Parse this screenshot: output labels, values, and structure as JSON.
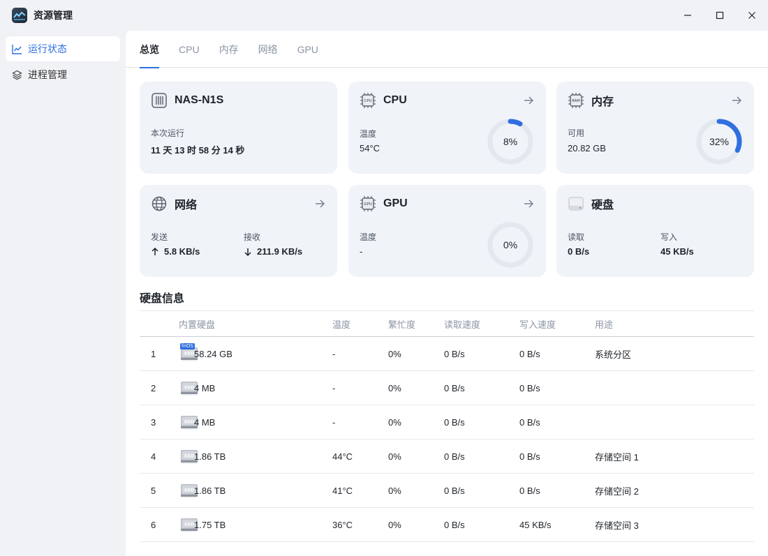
{
  "app": {
    "title": "资源管理"
  },
  "window_controls": {
    "minimize": "—",
    "maximize": "☐",
    "close": "✕"
  },
  "sidebar": {
    "items": [
      {
        "label": "运行状态",
        "icon": "line-chart-icon",
        "active": true
      },
      {
        "label": "进程管理",
        "icon": "layers-icon",
        "active": false
      }
    ]
  },
  "tabs": [
    {
      "label": "总览",
      "active": true
    },
    {
      "label": "CPU",
      "active": false
    },
    {
      "label": "内存",
      "active": false
    },
    {
      "label": "网络",
      "active": false
    },
    {
      "label": "GPU",
      "active": false
    }
  ],
  "cards": {
    "device": {
      "title": "NAS-N1S",
      "uptime_label": "本次运行",
      "uptime_value": "11 天 13 时 58 分 14 秒"
    },
    "cpu": {
      "title": "CPU",
      "temp_label": "温度",
      "temp_value": "54°C",
      "usage_text": "8%",
      "usage": 0.08
    },
    "memory": {
      "title": "内存",
      "avail_label": "可用",
      "avail_value": "20.82 GB",
      "usage_text": "32%",
      "usage": 0.32
    },
    "network": {
      "title": "网络",
      "send_label": "发送",
      "send_value": "5.8 KB/s",
      "recv_label": "接收",
      "recv_value": "211.9 KB/s"
    },
    "gpu": {
      "title": "GPU",
      "temp_label": "温度",
      "temp_value": "-",
      "usage_text": "0%",
      "usage": 0
    },
    "disk": {
      "title": "硬盘",
      "read_label": "读取",
      "read_value": "0 B/s",
      "write_label": "写入",
      "write_value": "45 KB/s"
    }
  },
  "disk_info": {
    "title": "硬盘信息",
    "columns": [
      "内置硬盘",
      "温度",
      "繁忙度",
      "读取速度",
      "写入速度",
      "用途"
    ],
    "rows": [
      {
        "idx": "1",
        "size": "58.24 GB",
        "temp": "-",
        "busy": "0%",
        "read": "0 B/s",
        "write": "0 B/s",
        "usage": "系统分区",
        "badge": "fnOS"
      },
      {
        "idx": "2",
        "size": "4 MB",
        "temp": "-",
        "busy": "0%",
        "read": "0 B/s",
        "write": "0 B/s",
        "usage": ""
      },
      {
        "idx": "3",
        "size": "4 MB",
        "temp": "-",
        "busy": "0%",
        "read": "0 B/s",
        "write": "0 B/s",
        "usage": ""
      },
      {
        "idx": "4",
        "size": "1.86 TB",
        "temp": "44°C",
        "busy": "0%",
        "read": "0 B/s",
        "write": "0 B/s",
        "usage": "存储空间 1"
      },
      {
        "idx": "5",
        "size": "1.86 TB",
        "temp": "41°C",
        "busy": "0%",
        "read": "0 B/s",
        "write": "0 B/s",
        "usage": "存储空间 2"
      },
      {
        "idx": "6",
        "size": "1.75 TB",
        "temp": "36°C",
        "busy": "0%",
        "read": "0 B/s",
        "write": "45 KB/s",
        "usage": "存储空间 3"
      }
    ]
  },
  "colors": {
    "accent": "#2f6fe0",
    "card_bg": "#f0f3f8",
    "gauge_track": "#e3e7ee"
  },
  "icon_labels": {
    "cpu_chip": "CPU",
    "ram_chip": "RAM",
    "gpu_chip": "GPU",
    "ssd": "SSD"
  }
}
